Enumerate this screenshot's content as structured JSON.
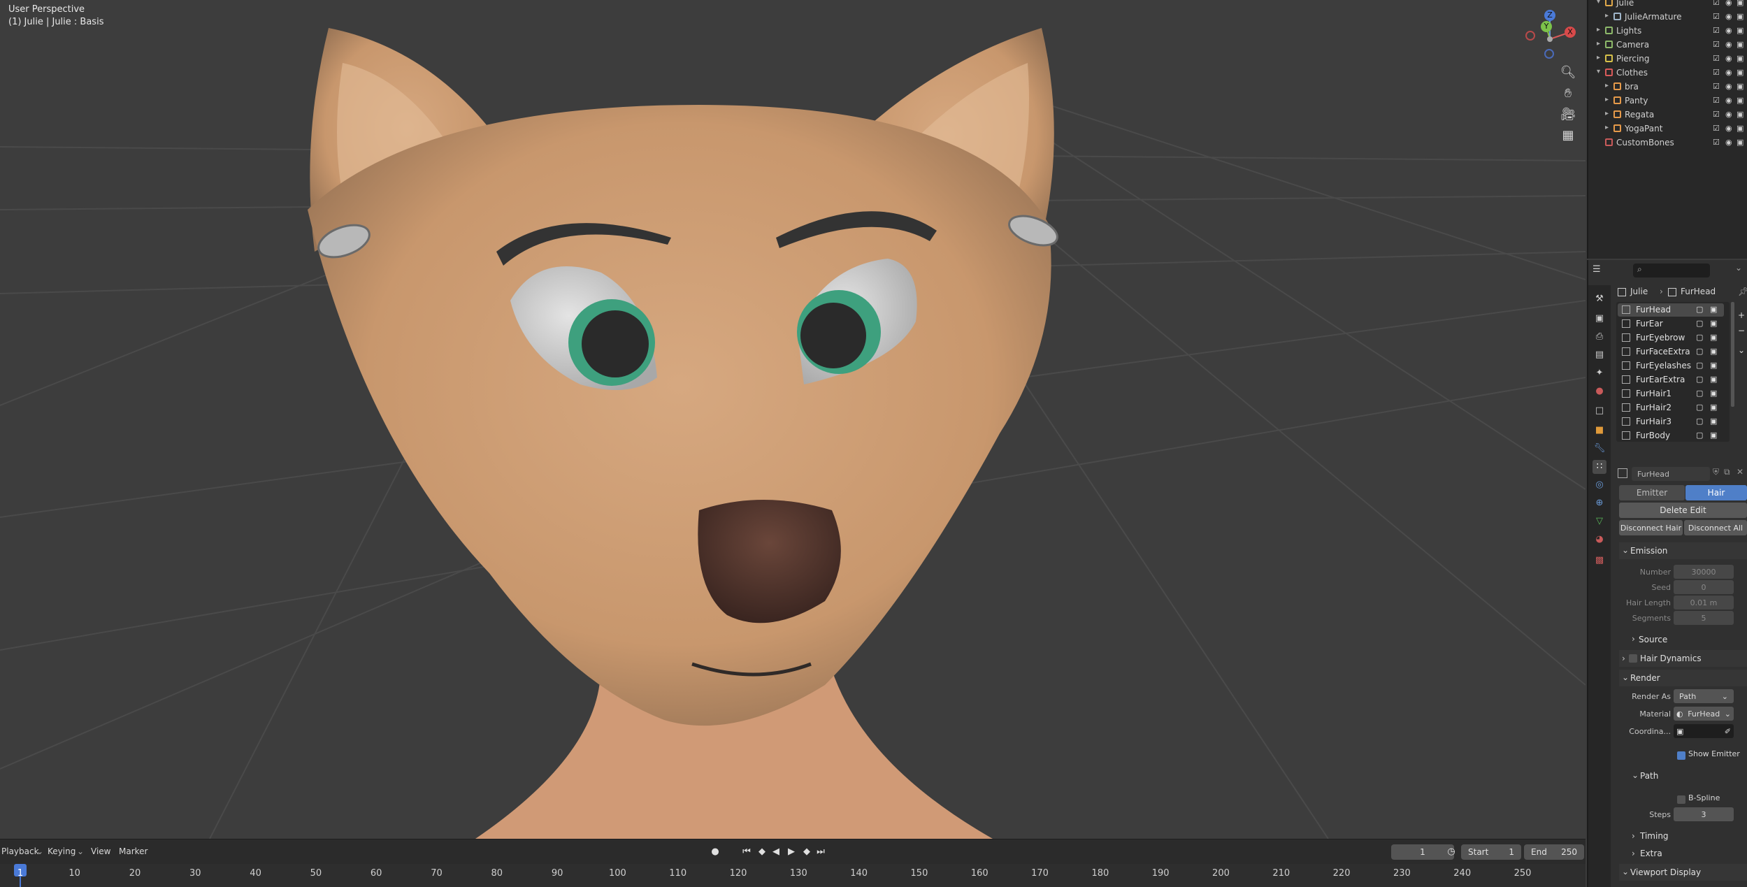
{
  "viewport": {
    "perspective_label": "User Perspective",
    "object_label": "(1) Julie | Julie : Basis",
    "nav_icons": [
      "zoom-icon",
      "hand-pan-icon",
      "camera-view-icon",
      "grid-ortho-icon"
    ],
    "gizmo_axes": {
      "z": "Z",
      "y": "Y",
      "x": "X"
    }
  },
  "timeline": {
    "menus": [
      "Playback",
      "Keying",
      "View",
      "Marker"
    ],
    "current_frame": "1",
    "start_label": "Start",
    "start_value": "1",
    "end_label": "End",
    "end_value": "250",
    "ruler_ticks": [
      "1",
      "10",
      "20",
      "30",
      "40",
      "50",
      "60",
      "70",
      "80",
      "90",
      "100",
      "110",
      "120",
      "130",
      "140",
      "150",
      "160",
      "170",
      "180",
      "190",
      "200",
      "210",
      "220",
      "230",
      "240",
      "250"
    ]
  },
  "outliner": {
    "rows": [
      {
        "label": "Julie",
        "color": "#e0a84a"
      },
      {
        "label": "JulieArmature",
        "color": "#9fb5c9"
      },
      {
        "label": "Lights",
        "color": "#8db86a"
      },
      {
        "label": "Camera",
        "color": "#8db86a"
      },
      {
        "label": "Piercing",
        "color": "#d6c14a"
      },
      {
        "label": "Clothes",
        "color": "#d85a5a"
      },
      {
        "label": "bra",
        "color": "#e69a4a"
      },
      {
        "label": "Panty",
        "color": "#e69a4a"
      },
      {
        "label": "Regata",
        "color": "#e69a4a"
      },
      {
        "label": "YogaPant",
        "color": "#e69a4a"
      },
      {
        "label": "CustomBones",
        "color": "#c85a5a"
      }
    ]
  },
  "properties": {
    "search_placeholder": "",
    "breadcrumb": {
      "object": "Julie",
      "psys": "FurHead"
    },
    "particle_systems": [
      "FurHead",
      "FurEar",
      "FurEyebrow",
      "FurFaceExtra",
      "FurEyelashes",
      "FurEarExtra",
      "FurHair1",
      "FurHair2",
      "FurHair3",
      "FurBody"
    ],
    "settings_name": "FurHead",
    "type_tabs": [
      "Emitter",
      "Hair"
    ],
    "active_type": "Hair",
    "delete_edit_label": "Delete Edit",
    "disconnect_hair_label": "Disconnect Hair",
    "disconnect_all_label": "Disconnect All",
    "emission": {
      "title": "Emission",
      "number_label": "Number",
      "number_value": "30000",
      "seed_label": "Seed",
      "seed_value": "0",
      "hair_length_label": "Hair Length",
      "hair_length_value": "0.01 m",
      "segments_label": "Segments",
      "segments_value": "5",
      "source_label": "Source"
    },
    "hair_dynamics_label": "Hair Dynamics",
    "render": {
      "title": "Render",
      "render_as_label": "Render As",
      "render_as_value": "Path",
      "material_label": "Material",
      "material_value": "FurHead",
      "coordinate_label": "Coordina...",
      "show_emitter_label": "Show Emitter",
      "path_label": "Path",
      "bspline_label": "B-Spline",
      "steps_label": "Steps",
      "steps_value": "3",
      "timing_label": "Timing",
      "extra_label": "Extra"
    },
    "viewport_display_label": "Viewport Display"
  }
}
